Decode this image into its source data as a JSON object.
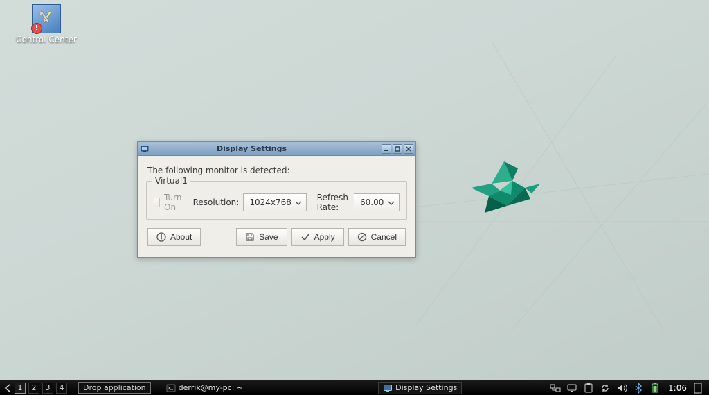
{
  "desktop": {
    "control_center_label": "Control Center"
  },
  "dialog": {
    "title": "Display Settings",
    "detected_label": "The following monitor is detected:",
    "monitor_name": "Virtual1",
    "turn_on_label": "Turn On",
    "resolution_label": "Resolution:",
    "resolution_value": "1024x768",
    "refresh_label": "Refresh Rate:",
    "refresh_value": "60.00",
    "about_label": "About",
    "save_label": "Save",
    "apply_label": "Apply",
    "cancel_label": "Cancel"
  },
  "taskbar": {
    "workspaces": [
      "1",
      "2",
      "3",
      "4"
    ],
    "active_workspace": 0,
    "drop_label": "Drop application",
    "tasks": [
      {
        "label": "derrik@my-pc: ~",
        "icon": "terminal"
      },
      {
        "label": "Display Settings",
        "icon": "display"
      }
    ],
    "active_task": 1,
    "clock": "1:06"
  }
}
